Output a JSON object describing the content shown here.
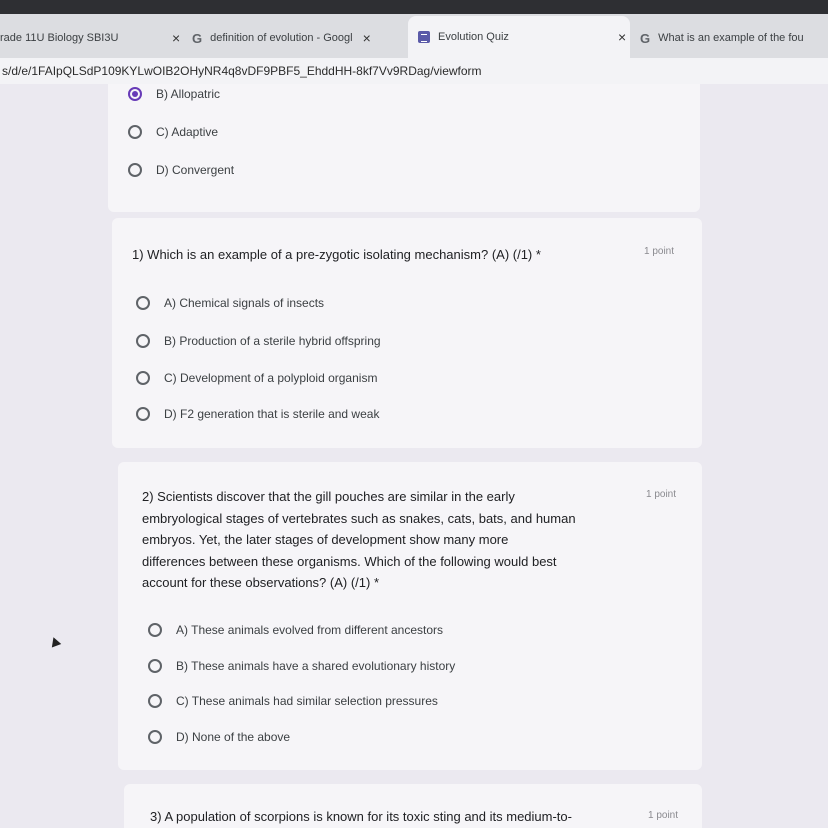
{
  "browser": {
    "tabs": [
      {
        "label": "rade 11U Biology SBI3U",
        "close": "×"
      },
      {
        "label": "definition of evolution - Googl",
        "close": "×"
      },
      {
        "label": "Evolution Quiz",
        "close": "×"
      },
      {
        "label": "What is an example of the fou"
      }
    ],
    "url": "s/d/e/1FAIpQLSdP109KYLwOIB2OHyNR4q8vDF9PBF5_EhddHH-8kf7Vv9RDag/viewform"
  },
  "prev_question": {
    "options": [
      "B) Allopatric",
      "C) Adaptive",
      "D) Convergent"
    ],
    "selected_index": 0
  },
  "questions": [
    {
      "title": "1) Which is an example of a pre-zygotic isolating mechanism? (A) (/1) *",
      "points": "1 point",
      "options": [
        "A) Chemical signals of insects",
        "B) Production of a sterile hybrid offspring",
        "C) Development of a polyploid organism",
        "D) F2 generation that is sterile and weak"
      ]
    },
    {
      "title_lines": [
        "2) Scientists discover that the gill pouches are similar in the early",
        "embryological stages of vertebrates such as snakes, cats, bats, and human",
        "embryos. Yet, the later stages of development show many more",
        "differences between these organisms. Which of the following would best",
        "account for these observations? (A) (/1) *"
      ],
      "points": "1 point",
      "options": [
        "A) These animals evolved from different ancestors",
        "B) These animals have a shared evolutionary history",
        "C) These animals had similar selection pressures",
        "D) None of the above"
      ]
    },
    {
      "title": "3) A population of scorpions is known for its toxic sting and its medium-to-",
      "points": "1 point"
    }
  ],
  "colors": {
    "accent": "#673ab7",
    "background": "#ebe9f0",
    "card": "#f6f5f8"
  }
}
